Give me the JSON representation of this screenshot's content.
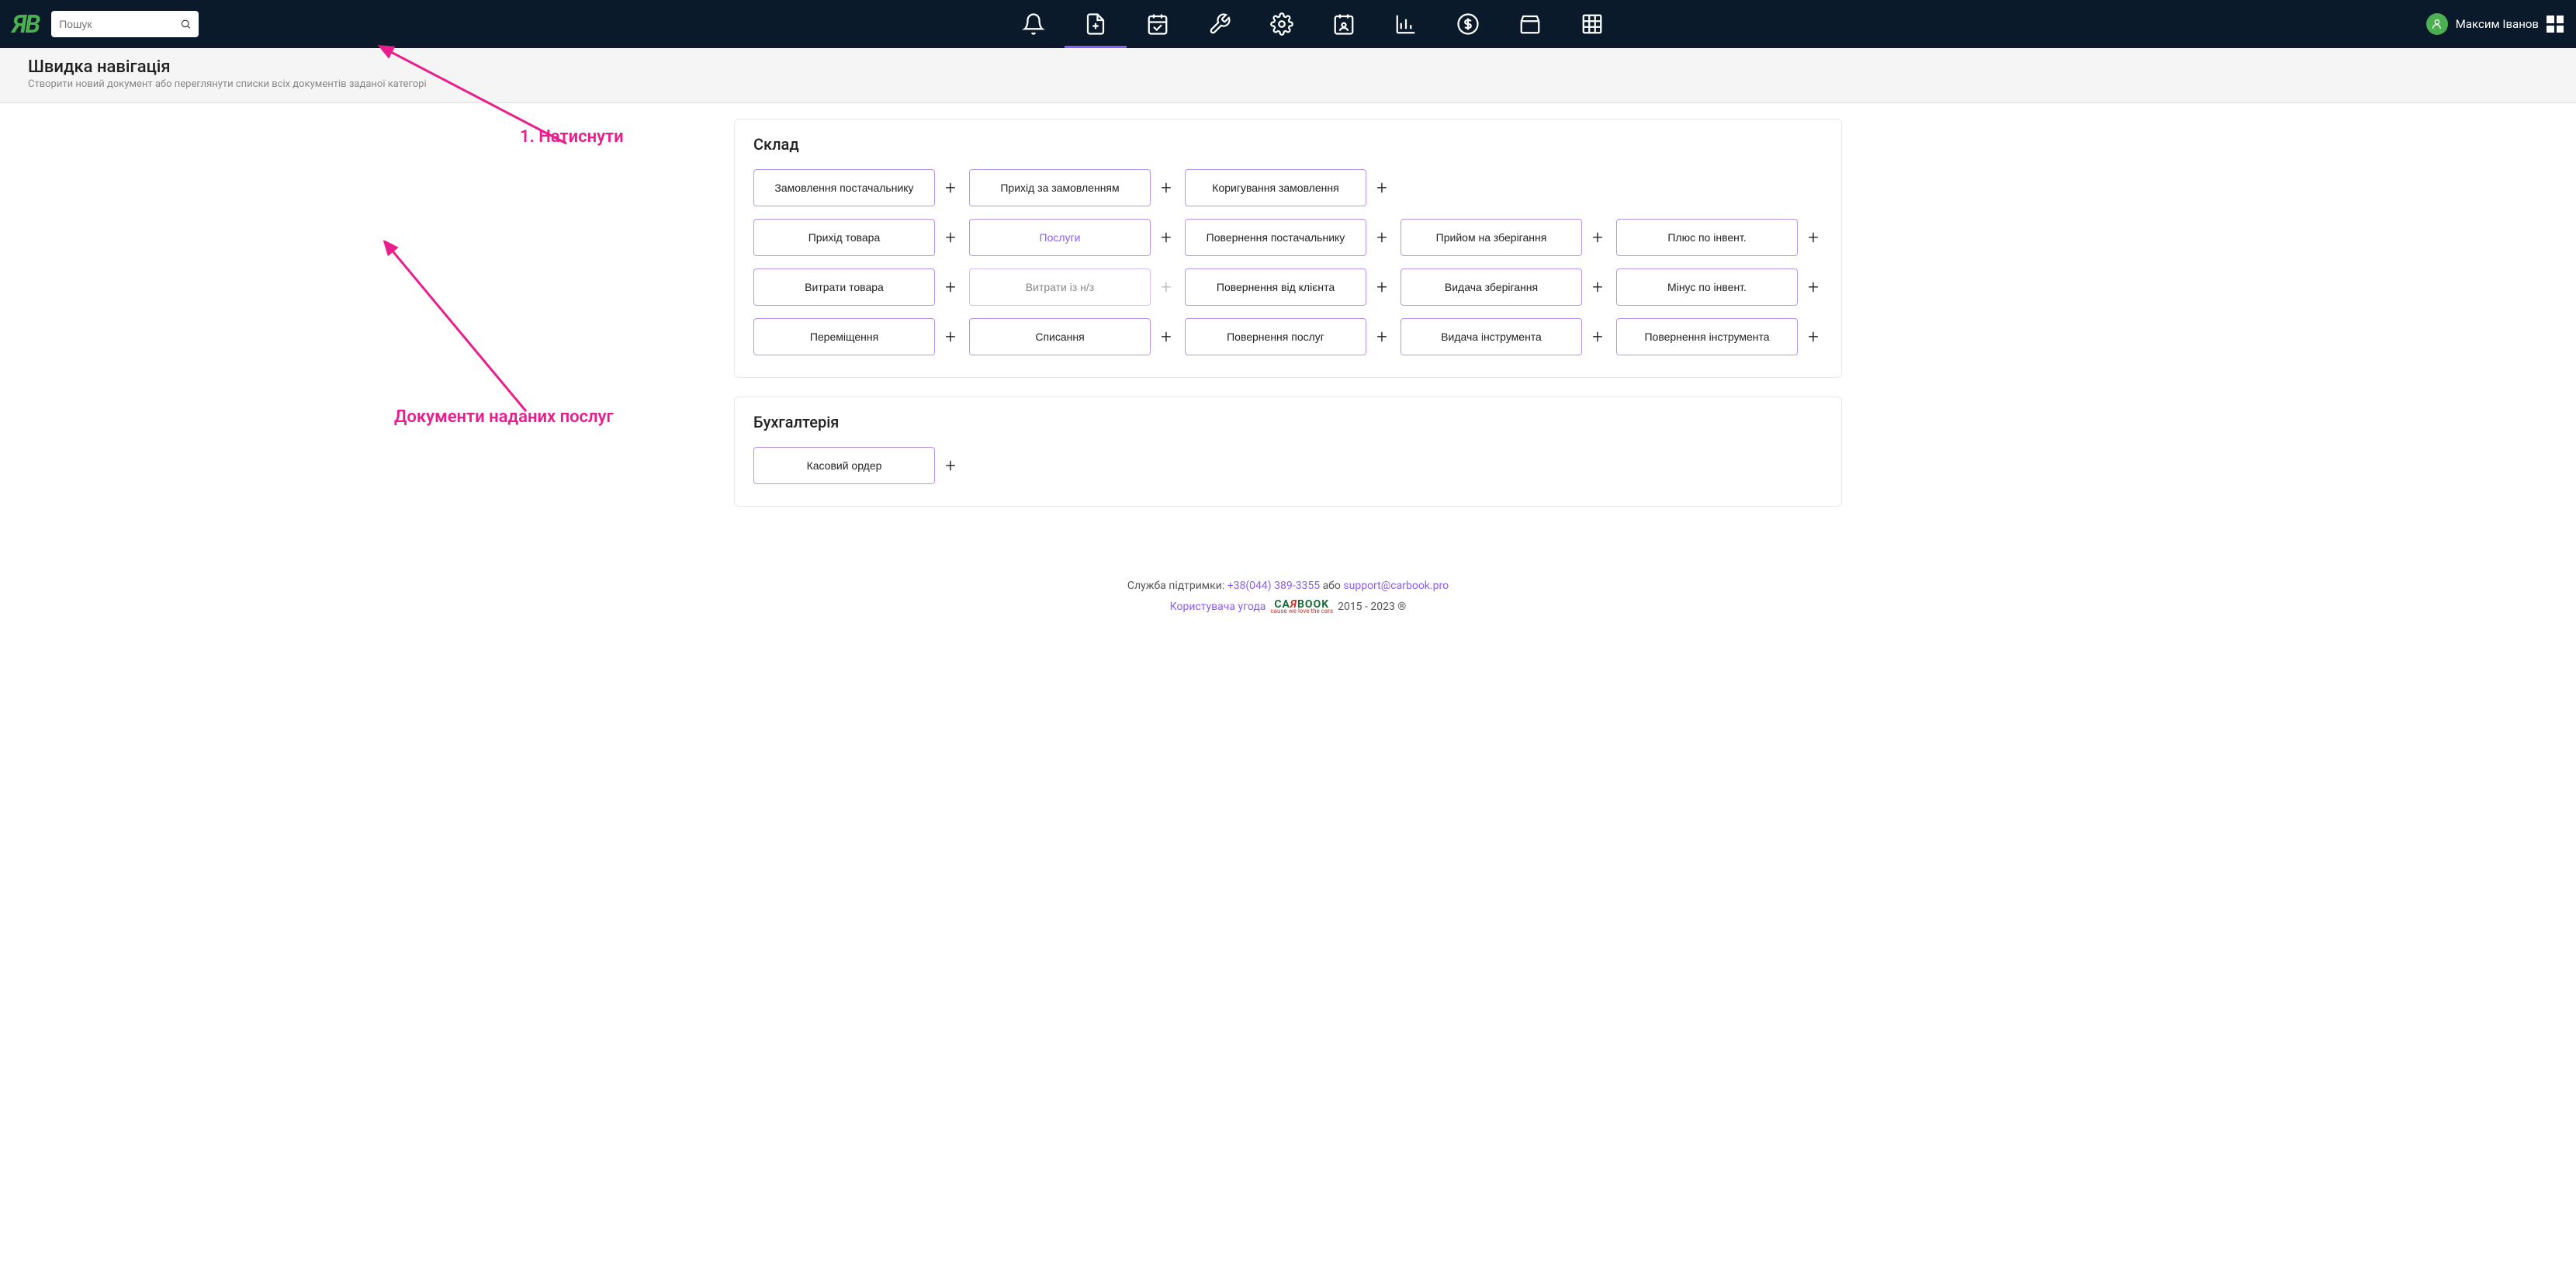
{
  "search": {
    "placeholder": "Пошук"
  },
  "user": {
    "name": "Максим Іванов"
  },
  "header": {
    "title": "Швидка навігація",
    "subtitle": "Створити новий документ або переглянути списки всіх документів заданої категорі"
  },
  "annotations": {
    "click": "1. Натиснути",
    "services_docs": "Документи наданих послуг"
  },
  "panels": [
    {
      "title": "Склад",
      "rows": [
        [
          {
            "label": "Замовлення постачальнику",
            "plus": true
          },
          {
            "label": "Прихід за замовленням",
            "plus": true
          },
          {
            "label": "Коригування замовлення",
            "plus": true
          },
          null,
          null
        ],
        [
          {
            "label": "Прихід товара",
            "plus": true
          },
          {
            "label": "Послуги",
            "plus": true,
            "highlighted": true
          },
          {
            "label": "Повернення постачальнику",
            "plus": true
          },
          {
            "label": "Прийом на зберігання",
            "plus": true
          },
          {
            "label": "Плюс по інвент.",
            "plus": true
          }
        ],
        [
          {
            "label": "Витрати товара",
            "plus": true
          },
          {
            "label": "Витрати із н/з",
            "plus": true,
            "plus_disabled": true,
            "disabled_look": true
          },
          {
            "label": "Повернення від клієнта",
            "plus": true
          },
          {
            "label": "Видача зберігання",
            "plus": true
          },
          {
            "label": "Мінус по інвент.",
            "plus": true
          }
        ],
        [
          {
            "label": "Переміщення",
            "plus": true
          },
          {
            "label": "Списання",
            "plus": true
          },
          {
            "label": "Повернення послуг",
            "plus": true
          },
          {
            "label": "Видача інструмента",
            "plus": true
          },
          {
            "label": "Повернення інструмента",
            "plus": true
          }
        ]
      ]
    },
    {
      "title": "Бухгалтерія",
      "rows": [
        [
          {
            "label": "Касовий ордер",
            "plus": true
          },
          null,
          null,
          null,
          null
        ]
      ]
    }
  ],
  "footer": {
    "support_label": "Служба підтримки:",
    "phone": "+38(044) 389-3355",
    "or": "або",
    "email": "support@carbook.pro",
    "agreement": "Користувача угода",
    "years": "2015 - 2023 ®"
  }
}
